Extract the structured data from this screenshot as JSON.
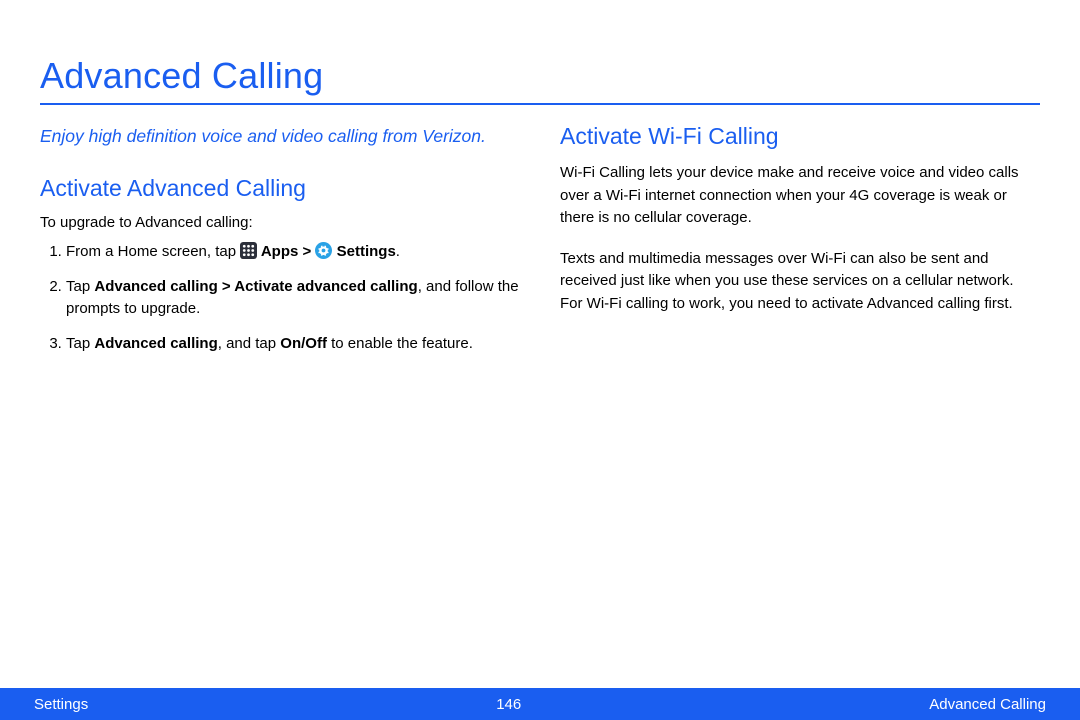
{
  "title": "Advanced Calling",
  "left": {
    "subtitle": "Enjoy high definition voice and video calling from Verizon.",
    "section_title": "Activate Advanced Calling",
    "intro": "To upgrade to Advanced calling:",
    "steps": {
      "s1_a": "From a Home screen, tap ",
      "s1_b": " Apps > ",
      "s1_c": " Settings",
      "s1_d": ".",
      "s2_a": "Tap ",
      "s2_b": "Advanced calling > Activate advanced calling",
      "s2_c": ", and follow the prompts to upgrade.",
      "s3_a": "Tap ",
      "s3_b": "Advanced calling",
      "s3_c": ", and tap ",
      "s3_d": "On/Off",
      "s3_e": " to enable the feature."
    }
  },
  "right": {
    "section_title": "Activate Wi-Fi Calling",
    "p1": "Wi-Fi Calling lets your device make and receive voice and video calls over a Wi-Fi internet connection when your 4G coverage is weak or there is no cellular coverage.",
    "p2": "Texts and multimedia messages over Wi-Fi can also be sent and received just like when you use these services on a cellular network. For Wi-Fi calling to work, you need to activate Advanced calling first."
  },
  "footer": {
    "left": "Settings",
    "center": "146",
    "right": "Advanced Calling"
  }
}
